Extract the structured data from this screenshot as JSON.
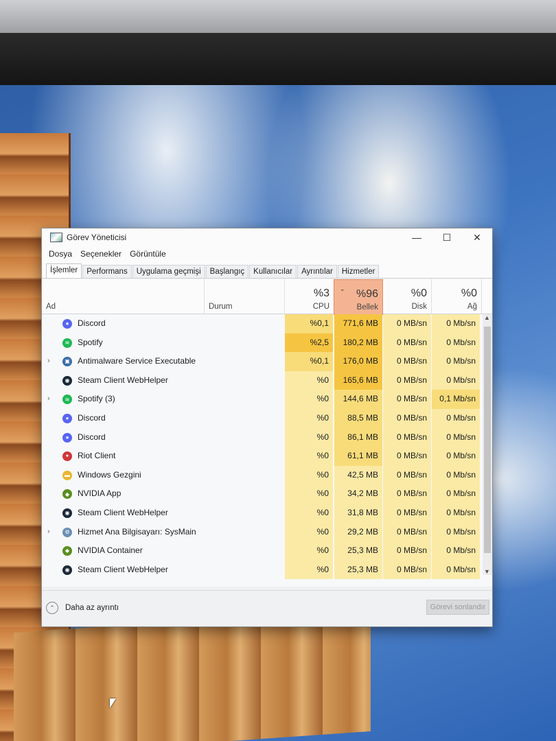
{
  "window": {
    "title": "Görev Yöneticisi",
    "minimize": "—",
    "maximize": "☐",
    "close": "✕"
  },
  "menu": [
    "Dosya",
    "Seçenekler",
    "Görüntüle"
  ],
  "tabs": [
    "İşlemler",
    "Performans",
    "Uygulama geçmişi",
    "Başlangıç",
    "Kullanıcılar",
    "Ayrıntılar",
    "Hizmetler"
  ],
  "columns": {
    "name": "Ad",
    "status": "Durum",
    "cpu": {
      "pct": "%3",
      "label": "CPU"
    },
    "memory": {
      "pct": "%96",
      "label": "Bellek"
    },
    "disk": {
      "pct": "%0",
      "label": "Disk"
    },
    "network": {
      "pct": "%0",
      "label": "Ağ"
    }
  },
  "processes": [
    {
      "name": "Discord",
      "expandable": false,
      "icon": "discord-icon",
      "cpu": "%0,1",
      "memory": "771,6 MB",
      "disk": "0 MB/sn",
      "network": "0 Mb/sn"
    },
    {
      "name": "Spotify",
      "expandable": false,
      "icon": "spotify-icon",
      "cpu": "%2,5",
      "memory": "180,2 MB",
      "disk": "0 MB/sn",
      "network": "0 Mb/sn"
    },
    {
      "name": "Antimalware Service Executable",
      "expandable": true,
      "icon": "antimalware-icon",
      "cpu": "%0,1",
      "memory": "176,0 MB",
      "disk": "0 MB/sn",
      "network": "0 Mb/sn"
    },
    {
      "name": "Steam Client WebHelper",
      "expandable": false,
      "icon": "steam-icon",
      "cpu": "%0",
      "memory": "165,6 MB",
      "disk": "0 MB/sn",
      "network": "0 Mb/sn"
    },
    {
      "name": "Spotify (3)",
      "expandable": true,
      "icon": "spotify-icon",
      "cpu": "%0",
      "memory": "144,6 MB",
      "disk": "0 MB/sn",
      "network": "0,1 Mb/sn"
    },
    {
      "name": "Discord",
      "expandable": false,
      "icon": "discord-icon",
      "cpu": "%0",
      "memory": "88,5 MB",
      "disk": "0 MB/sn",
      "network": "0 Mb/sn"
    },
    {
      "name": "Discord",
      "expandable": false,
      "icon": "discord-icon",
      "cpu": "%0",
      "memory": "86,1 MB",
      "disk": "0 MB/sn",
      "network": "0 Mb/sn"
    },
    {
      "name": "Riot Client",
      "expandable": false,
      "icon": "riot-icon",
      "cpu": "%0",
      "memory": "61,1 MB",
      "disk": "0 MB/sn",
      "network": "0 Mb/sn"
    },
    {
      "name": "Windows Gezgini",
      "expandable": false,
      "icon": "folder-icon",
      "cpu": "%0",
      "memory": "42,5 MB",
      "disk": "0 MB/sn",
      "network": "0 Mb/sn"
    },
    {
      "name": "NVIDIA App",
      "expandable": false,
      "icon": "nvidia-icon",
      "cpu": "%0",
      "memory": "34,2 MB",
      "disk": "0 MB/sn",
      "network": "0 Mb/sn"
    },
    {
      "name": "Steam Client WebHelper",
      "expandable": false,
      "icon": "steam-icon",
      "cpu": "%0",
      "memory": "31,8 MB",
      "disk": "0 MB/sn",
      "network": "0 Mb/sn"
    },
    {
      "name": "Hizmet Ana Bilgisayarı: SysMain",
      "expandable": true,
      "icon": "gear-icon",
      "cpu": "%0",
      "memory": "29,2 MB",
      "disk": "0 MB/sn",
      "network": "0 Mb/sn"
    },
    {
      "name": "NVIDIA Container",
      "expandable": false,
      "icon": "nvidia-icon",
      "cpu": "%0",
      "memory": "25,3 MB",
      "disk": "0 MB/sn",
      "network": "0 Mb/sn"
    },
    {
      "name": "Steam Client WebHelper",
      "expandable": false,
      "icon": "steam-icon",
      "cpu": "%0",
      "memory": "25,3 MB",
      "disk": "0 MB/sn",
      "network": "0 Mb/sn"
    }
  ],
  "footer": {
    "fewer_details": "Daha az ayrıntı",
    "end_task": "Görevi sonlandır"
  },
  "colors": {
    "memory_header": "#f4b493",
    "heat_high": "#f5c542",
    "heat_mid": "#f8dc7a",
    "heat_low": "#fbeaa6"
  }
}
